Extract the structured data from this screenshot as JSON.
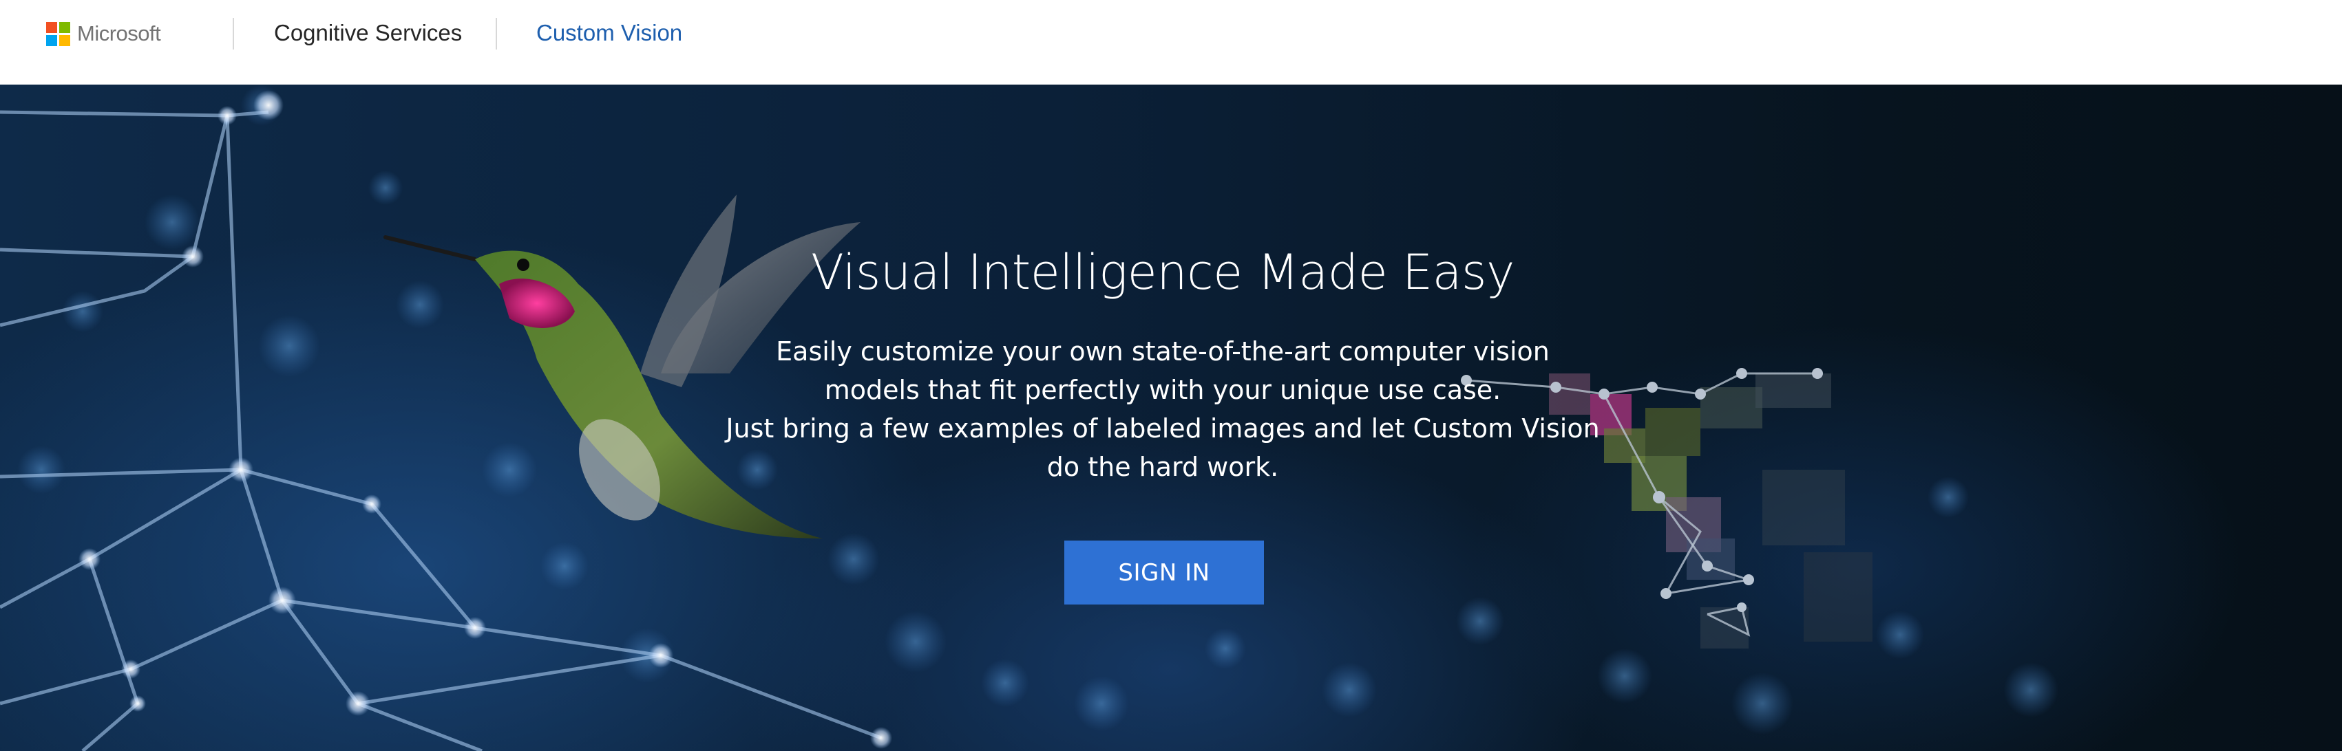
{
  "header": {
    "brand_name": "Microsoft",
    "brand_colors": [
      "#f25022",
      "#7fba00",
      "#00a4ef",
      "#ffb900"
    ],
    "nav": [
      {
        "label": "Cognitive Services"
      },
      {
        "label": "Custom Vision",
        "color": "#1e5fae"
      }
    ]
  },
  "hero": {
    "title": "Visual Intelligence Made Easy",
    "description_lines": [
      "Easily customize your own state-of-the-art computer vision",
      "models that fit perfectly with your unique use case.",
      "Just bring a few examples of labeled images and let Custom Vision",
      "do the hard work."
    ],
    "cta_label": "SIGN IN",
    "cta_color": "#2e71d4",
    "background_image": "hummingbird-network-art"
  }
}
